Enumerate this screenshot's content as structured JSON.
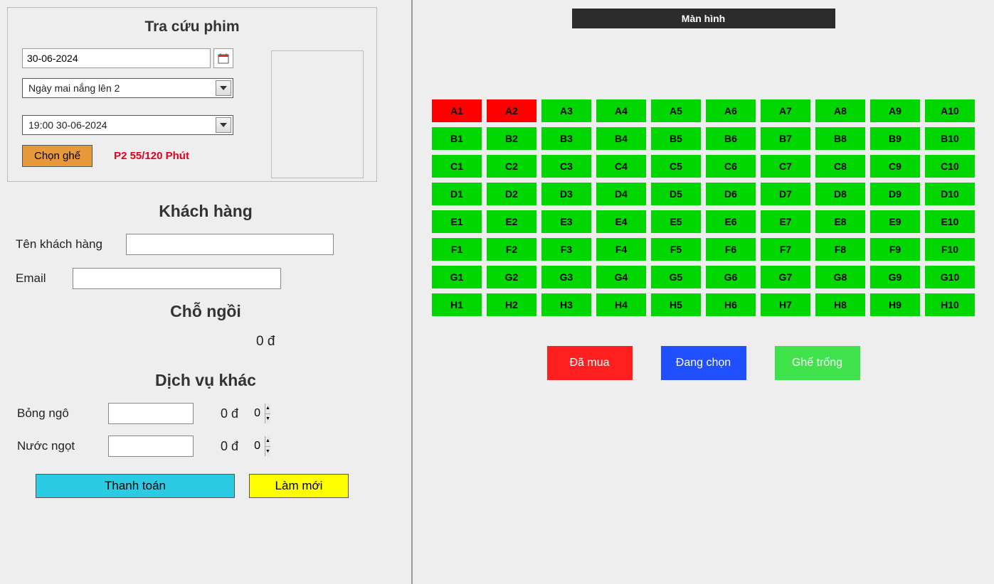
{
  "lookup": {
    "title": "Tra cứu phim",
    "date": "30-06-2024",
    "movie": "Ngày mai nắng lên 2",
    "showtime": "19:00 30-06-2024",
    "choose_seat_label": "Chọn ghế",
    "status": "P2 55/120 Phút"
  },
  "customer": {
    "title": "Khách hàng",
    "name_label": "Tên khách hàng",
    "name_value": "",
    "email_label": "Email",
    "email_value": ""
  },
  "seating": {
    "title": "Chỗ ngồi",
    "price": "0 đ"
  },
  "services": {
    "title": "Dịch vụ khác",
    "popcorn_label": "Bỏng ngô",
    "popcorn_qty": "0",
    "popcorn_price": "0 đ",
    "drink_label": "Nước ngọt",
    "drink_qty": "0",
    "drink_price": "0 đ"
  },
  "actions": {
    "pay": "Thanh toán",
    "reset": "Làm mới"
  },
  "screen_label": "Màn hình",
  "seat_rows": [
    "A",
    "B",
    "C",
    "D",
    "E",
    "F",
    "G",
    "H"
  ],
  "seat_cols": [
    1,
    2,
    3,
    4,
    5,
    6,
    7,
    8,
    9,
    10
  ],
  "sold_seats": [
    "A1",
    "A2"
  ],
  "legend": {
    "sold": "Đã mua",
    "selecting": "Đang chọn",
    "available": "Ghế trống"
  }
}
